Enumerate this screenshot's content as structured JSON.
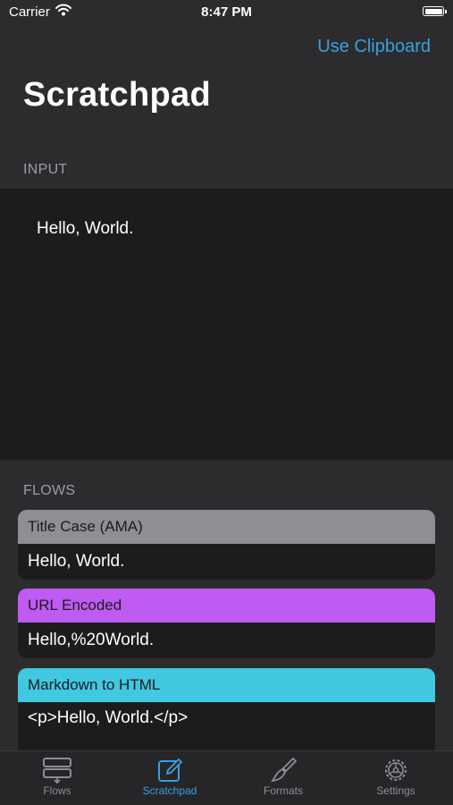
{
  "status": {
    "carrier": "Carrier",
    "time": "8:47 PM"
  },
  "nav": {
    "use_clipboard": "Use Clipboard",
    "title": "Scratchpad"
  },
  "input": {
    "header": "INPUT",
    "text": "Hello, World."
  },
  "flows": {
    "header": "FLOWS",
    "items": [
      {
        "name": "Title Case (AMA)",
        "output": "Hello, World.",
        "color": "#8e8e93"
      },
      {
        "name": "URL Encoded",
        "output": "Hello,%20World.",
        "color": "#bf5af2"
      },
      {
        "name": "Markdown to HTML",
        "output": "<p>Hello, World.</p>",
        "color": "#40c8e0"
      }
    ]
  },
  "tabs": [
    {
      "label": "Flows",
      "icon": "flows-icon",
      "active": false
    },
    {
      "label": "Scratchpad",
      "icon": "compose-icon",
      "active": true
    },
    {
      "label": "Formats",
      "icon": "paintbrush-icon",
      "active": false
    },
    {
      "label": "Settings",
      "icon": "gear-icon",
      "active": false
    }
  ],
  "colors": {
    "accent": "#3a9fe0",
    "background": "#2c2c2e",
    "panel": "#1c1c1e"
  }
}
